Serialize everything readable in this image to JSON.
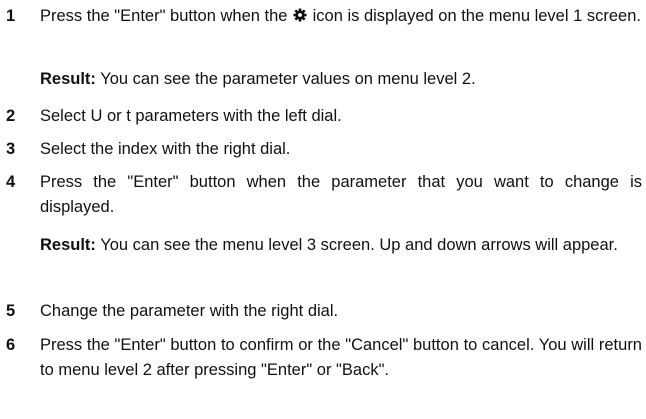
{
  "steps": [
    {
      "number": "1",
      "text_before_icon": "Press the \"Enter\" button when the ",
      "icon": "gear-icon",
      "text_after_icon": " icon is displayed on the menu level 1 screen.",
      "result_label": "Result:",
      "result_text": " You can see the parameter values on menu level 2."
    },
    {
      "number": "2",
      "text": "Select U or t parameters with the left dial."
    },
    {
      "number": "3",
      "text": "Select the index with the right dial."
    },
    {
      "number": "4",
      "text": "Press the \"Enter\" button when the parameter that you want to change is displayed.",
      "result_label": "Result:",
      "result_text": " You can see the menu level 3 screen. Up and down arrows will appear."
    },
    {
      "number": "5",
      "text": "Change the parameter with the right dial."
    },
    {
      "number": "6",
      "text": "Press the \"Enter\" button to confirm or the \"Cancel\" button to cancel. You will return to menu level 2 after pressing \"Enter\" or \"Back\"."
    }
  ]
}
